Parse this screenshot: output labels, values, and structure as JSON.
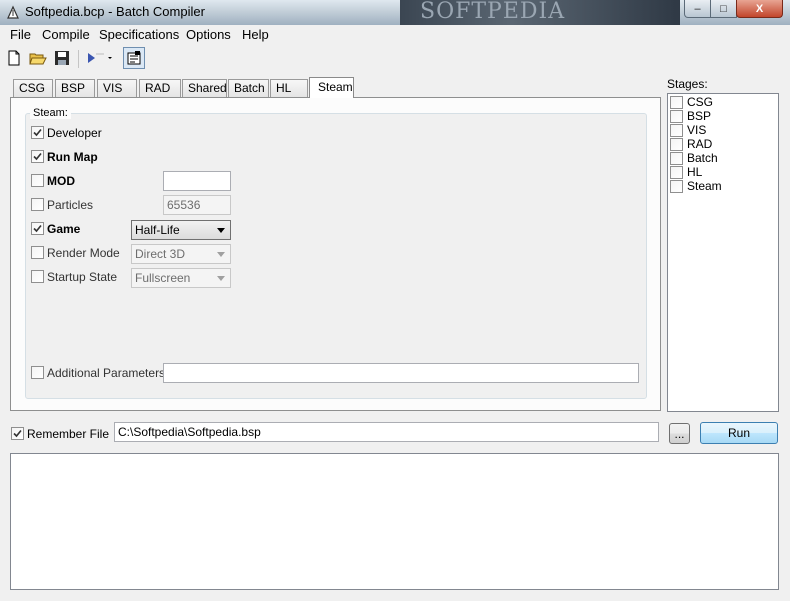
{
  "window": {
    "title": "Softpedia.bcp - Batch Compiler",
    "watermark": "SOFTPEDIA",
    "controls": {
      "minimize": "–",
      "maximize": "□",
      "close": "X"
    }
  },
  "menu": [
    "File",
    "Compile",
    "Specifications",
    "Options",
    "Help"
  ],
  "toolbar": {
    "icons": [
      "new-file-icon",
      "open-folder-icon",
      "save-icon",
      "run-dropdown-icon",
      "properties-icon"
    ]
  },
  "tabs": [
    {
      "label": "CSG",
      "active": false
    },
    {
      "label": "BSP",
      "active": false
    },
    {
      "label": "VIS",
      "active": false
    },
    {
      "label": "RAD",
      "active": false
    },
    {
      "label": "Shared",
      "active": false
    },
    {
      "label": "Batch",
      "active": false
    },
    {
      "label": "HL",
      "active": false
    },
    {
      "label": "Steam",
      "active": true
    }
  ],
  "steam": {
    "group_label": "Steam:",
    "developer": {
      "label": "Developer",
      "checked": true
    },
    "run_map": {
      "label": "Run Map",
      "checked": true
    },
    "mod": {
      "label": "MOD",
      "checked": false,
      "value": ""
    },
    "particles": {
      "label": "Particles",
      "checked": false,
      "value": "65536"
    },
    "game": {
      "label": "Game",
      "checked": true,
      "selected": "Half-Life"
    },
    "render_mode": {
      "label": "Render Mode",
      "checked": false,
      "selected": "Direct 3D"
    },
    "startup_state": {
      "label": "Startup State",
      "checked": false,
      "selected": "Fullscreen"
    },
    "additional_parameters": {
      "label": "Additional Parameters",
      "checked": false,
      "value": ""
    }
  },
  "stages": {
    "label": "Stages:",
    "items": [
      {
        "label": "CSG",
        "checked": false
      },
      {
        "label": "BSP",
        "checked": false
      },
      {
        "label": "VIS",
        "checked": false
      },
      {
        "label": "RAD",
        "checked": false
      },
      {
        "label": "Batch",
        "checked": false
      },
      {
        "label": "HL",
        "checked": false
      },
      {
        "label": "Steam",
        "checked": false
      }
    ]
  },
  "bottom": {
    "remember_file": {
      "label": "Remember File",
      "checked": true
    },
    "file_path": "C:\\Softpedia\\Softpedia.bsp",
    "browse_label": "...",
    "run_label": "Run"
  },
  "output": ""
}
